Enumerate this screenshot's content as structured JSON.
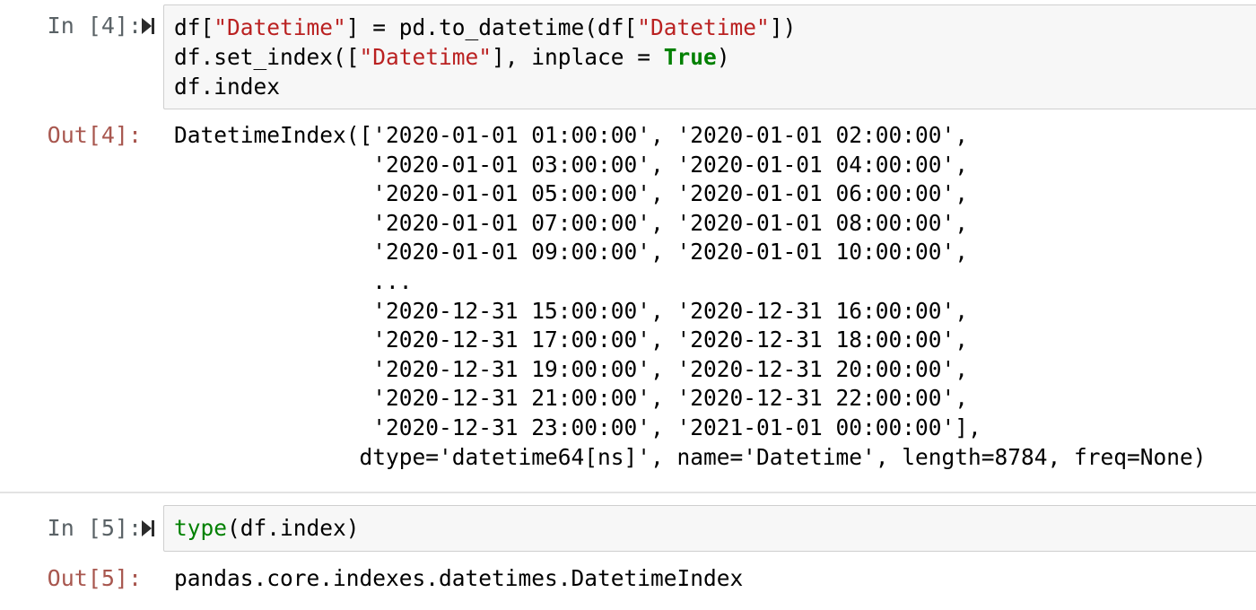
{
  "cells": [
    {
      "in_prompt": "In [4]:",
      "out_prompt": "Out[4]:",
      "code_lines": [
        [
          {
            "t": "df[",
            "c": ""
          },
          {
            "t": "\"Datetime\"",
            "c": "str"
          },
          {
            "t": "] = pd.to_datetime(df[",
            "c": ""
          },
          {
            "t": "\"Datetime\"",
            "c": "str"
          },
          {
            "t": "])",
            "c": ""
          }
        ],
        [
          {
            "t": "df.set_index([",
            "c": ""
          },
          {
            "t": "\"Datetime\"",
            "c": "str"
          },
          {
            "t": "], inplace = ",
            "c": ""
          },
          {
            "t": "True",
            "c": "kw"
          },
          {
            "t": ")",
            "c": ""
          }
        ],
        [
          {
            "t": "df.index",
            "c": ""
          }
        ]
      ],
      "output_lines": [
        "DatetimeIndex(['2020-01-01 01:00:00', '2020-01-01 02:00:00',",
        "               '2020-01-01 03:00:00', '2020-01-01 04:00:00',",
        "               '2020-01-01 05:00:00', '2020-01-01 06:00:00',",
        "               '2020-01-01 07:00:00', '2020-01-01 08:00:00',",
        "               '2020-01-01 09:00:00', '2020-01-01 10:00:00',",
        "               ...",
        "               '2020-12-31 15:00:00', '2020-12-31 16:00:00',",
        "               '2020-12-31 17:00:00', '2020-12-31 18:00:00',",
        "               '2020-12-31 19:00:00', '2020-12-31 20:00:00',",
        "               '2020-12-31 21:00:00', '2020-12-31 22:00:00',",
        "               '2020-12-31 23:00:00', '2021-01-01 00:00:00'],",
        "              dtype='datetime64[ns]', name='Datetime', length=8784, freq=None)"
      ]
    },
    {
      "in_prompt": "In [5]:",
      "out_prompt": "Out[5]:",
      "code_lines": [
        [
          {
            "t": "type",
            "c": "bi"
          },
          {
            "t": "(df.index)",
            "c": ""
          }
        ]
      ],
      "output_lines": [
        "pandas.core.indexes.datetimes.DatetimeIndex"
      ]
    }
  ],
  "icons": {
    "run": "run-cell-icon"
  },
  "colors": {
    "in_prompt": "#5a6266",
    "out_prompt": "#a8574f",
    "string": "#ba2121",
    "keyword": "#008000",
    "input_bg": "#f7f7f7",
    "input_border": "#cfcfcf"
  }
}
